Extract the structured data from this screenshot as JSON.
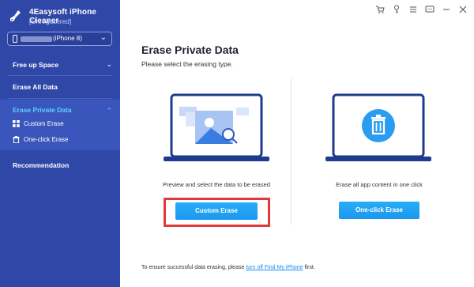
{
  "app": {
    "name": "4Easysoft iPhone Cleaner",
    "registration": "[Unregistered]"
  },
  "device": {
    "label": "(iPhone 8)"
  },
  "sidebar": {
    "free_up_space": "Free up Space",
    "erase_all_data": "Erase All Data",
    "erase_private_data": "Erase Private Data",
    "custom_erase": "Custom Erase",
    "one_click_erase": "One-click Erase",
    "recommendation": "Recommendation"
  },
  "window_icons": [
    "cart-icon",
    "key-icon",
    "menu-icon",
    "feedback-icon",
    "minimize-icon",
    "close-icon"
  ],
  "main": {
    "title": "Erase Private Data",
    "subtitle": "Please select the erasing type.",
    "custom": {
      "description": "Preview and select the data to be erased",
      "button": "Custom Erase"
    },
    "oneclick": {
      "description": "Erase all app content in one click",
      "button": "One-click Erase"
    },
    "footer": {
      "prefix": "To ensure successful data erasing, please ",
      "link": "turn off Find My iPhone",
      "suffix": " first."
    }
  },
  "colors": {
    "sidebar": "#2f47a6",
    "accent": "#1c97ee",
    "active_text": "#5fd0ff",
    "highlight": "#e13a3a"
  }
}
